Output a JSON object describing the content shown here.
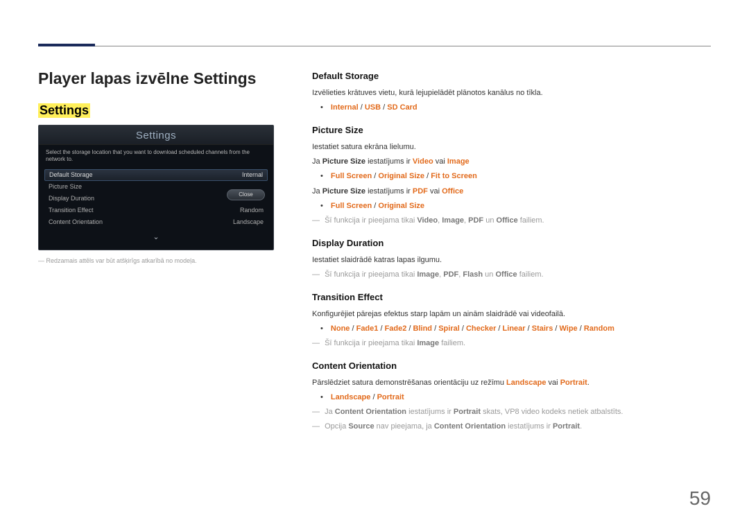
{
  "page_number": "59",
  "left": {
    "title": "Player lapas izvēlne Settings",
    "highlight": "Settings",
    "panel": {
      "title": "Settings",
      "description": "Select the storage location that you want to download scheduled channels from the network to.",
      "rows": [
        {
          "label": "Default Storage",
          "value": "Internal",
          "selected": true
        },
        {
          "label": "Picture Size",
          "value": "",
          "selected": false
        },
        {
          "label": "Display Duration",
          "value": "",
          "selected": false
        },
        {
          "label": "Transition Effect",
          "value": "Random",
          "selected": false
        },
        {
          "label": "Content Orientation",
          "value": "Landscape",
          "selected": false
        }
      ],
      "close": "Close"
    },
    "footnote": "Redzamais attēls var būt atšķirīgs atkarībā no modeļa."
  },
  "right": {
    "default_storage": {
      "h": "Default Storage",
      "desc": "Izvēlieties krātuves vietu, kurā lejupielādēt plānotos kanālus no tīkla.",
      "opts": {
        "a": "Internal",
        "b": "USB",
        "c": "SD Card"
      }
    },
    "picture_size": {
      "h": "Picture Size",
      "desc": "Iestatiet satura ekrāna lielumu.",
      "line1_pre": "Ja ",
      "line1_b1": "Picture Size",
      "line1_mid": " iestatījums ir ",
      "line1_b2": "Video",
      "line1_or": " vai ",
      "line1_b3": "Image",
      "opts1": {
        "a": "Full Screen",
        "b": "Original Size",
        "c": "Fit to Screen"
      },
      "line2_pre": "Ja ",
      "line2_b1": "Picture Size",
      "line2_mid": " iestatījums ir ",
      "line2_b2": "PDF",
      "line2_or": " vai ",
      "line2_b3": "Office",
      "opts2": {
        "a": "Full Screen",
        "b": "Original Size"
      },
      "note_pre": "Šī funkcija ir pieejama tikai ",
      "note_b1": "Video",
      "note_s1": ", ",
      "note_b2": "Image",
      "note_s2": ", ",
      "note_b3": "PDF",
      "note_s3": " un ",
      "note_b4": "Office",
      "note_end": " failiem."
    },
    "display_duration": {
      "h": "Display Duration",
      "desc": "Iestatiet slaidrādē katras lapas ilgumu.",
      "note_pre": "Šī funkcija ir pieejama tikai ",
      "note_b1": "Image",
      "note_s1": ", ",
      "note_b2": "PDF",
      "note_s2": ", ",
      "note_b3": "Flash",
      "note_s3": " un ",
      "note_b4": "Office",
      "note_end": " failiem."
    },
    "transition_effect": {
      "h": "Transition Effect",
      "desc": "Konfigurējiet pārejas efektus starp lapām un ainām slaidrādē vai videofailā.",
      "opts": {
        "a": "None",
        "b": "Fade1",
        "c": "Fade2",
        "d": "Blind",
        "e": "Spiral",
        "f": "Checker",
        "g": "Linear",
        "h": "Stairs",
        "i": "Wipe",
        "j": "Random"
      },
      "note_pre": "Šī funkcija ir pieejama tikai ",
      "note_b1": "Image",
      "note_end": " failiem."
    },
    "content_orientation": {
      "h": "Content Orientation",
      "desc_pre": "Pārslēdziet satura demonstrēšanas orientāciju uz režīmu ",
      "desc_b1": "Landscape",
      "desc_or": " vai ",
      "desc_b2": "Portrait",
      "desc_end": ".",
      "opts": {
        "a": "Landscape",
        "b": "Portrait"
      },
      "note1_pre": "Ja ",
      "note1_b1": "Content Orientation",
      "note1_mid": " iestatījums ir ",
      "note1_b2": "Portrait",
      "note1_end": " skats, VP8 video kodeks netiek atbalstīts.",
      "note2_pre": "Opcija ",
      "note2_b1": "Source",
      "note2_mid": " nav pieejama, ja ",
      "note2_b2": "Content Orientation",
      "note2_mid2": " iestatījums ir ",
      "note2_b3": "Portrait",
      "note2_end": "."
    }
  }
}
